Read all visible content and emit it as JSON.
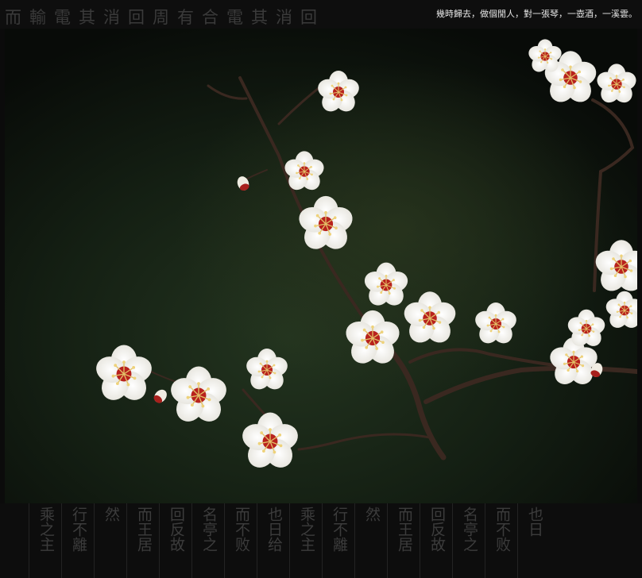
{
  "banner": {
    "caption": "幾時歸去，做個閒人，對一張琴，一壺酒，一溪雲。",
    "background_calligraphy": "而輸電其消回周有合電其消回"
  },
  "photo": {
    "subject_icon": "plum-blossom-branch",
    "colors": {
      "background_dark": "#0f1a0f",
      "petal": "#f6f4ee",
      "center": "#c22a24",
      "stamen": "#e7c86a",
      "branch": "#3b2a22"
    }
  },
  "footer": {
    "columns": [
      "乘之主",
      "行不離",
      "然",
      "而王居",
      "回反故",
      "名亭之",
      "而不败",
      "也日给",
      "乘之主",
      "行不離",
      "然",
      "而王居",
      "回反故",
      "名亭之",
      "而不败",
      "也日"
    ]
  }
}
